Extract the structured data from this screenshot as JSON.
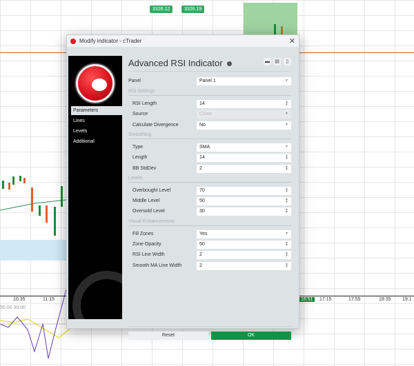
{
  "chart": {
    "price_badges": [
      "3326.12",
      "3326.19"
    ],
    "time_labels": [
      "10:35",
      "11:15",
      "17:15",
      "17:55",
      "18:35",
      "19:1"
    ],
    "current_time": "16:51",
    "level_labels": "50.00  30.00"
  },
  "dialog": {
    "title": "Modify indicator - cTrader",
    "heading": "Advanced RSI Indicator",
    "sidebar": [
      {
        "label": "Parameters",
        "active": true
      },
      {
        "label": "Lines"
      },
      {
        "label": "Levels"
      },
      {
        "label": "Additional"
      }
    ],
    "panel": {
      "label": "Panel",
      "value": "Panel 1"
    },
    "sections": [
      {
        "title": "RSI Settings",
        "fields": [
          {
            "label": "RSI Length",
            "value": "14",
            "kind": "number"
          },
          {
            "label": "Source",
            "value": "Close",
            "kind": "select",
            "disabled": true
          },
          {
            "label": "Calculate Divergence",
            "value": "No",
            "kind": "select"
          }
        ]
      },
      {
        "title": "Smoothing",
        "fields": [
          {
            "label": "Type",
            "value": "SMA",
            "kind": "select"
          },
          {
            "label": "Length",
            "value": "14",
            "kind": "number"
          },
          {
            "label": "BB StdDev",
            "value": "2",
            "kind": "number"
          }
        ]
      },
      {
        "title": "Levels",
        "fields": [
          {
            "label": "Overbought Level",
            "value": "70",
            "kind": "number"
          },
          {
            "label": "Middle Level",
            "value": "50",
            "kind": "number"
          },
          {
            "label": "Oversold Level",
            "value": "30",
            "kind": "number"
          }
        ]
      },
      {
        "title": "Visual Enhancements",
        "fields": [
          {
            "label": "Fill Zones",
            "value": "Yes",
            "kind": "select"
          },
          {
            "label": "Zone Opacity",
            "value": "50",
            "kind": "number"
          },
          {
            "label": "RSI Line Width",
            "value": "2",
            "kind": "number"
          },
          {
            "label": "Smooth MA Line Width",
            "value": "2",
            "kind": "number"
          }
        ]
      }
    ],
    "reset_label": "Reset",
    "ok_label": "OK",
    "colors": {
      "accent": "#0f9447",
      "brand": "#e01d2a"
    }
  }
}
